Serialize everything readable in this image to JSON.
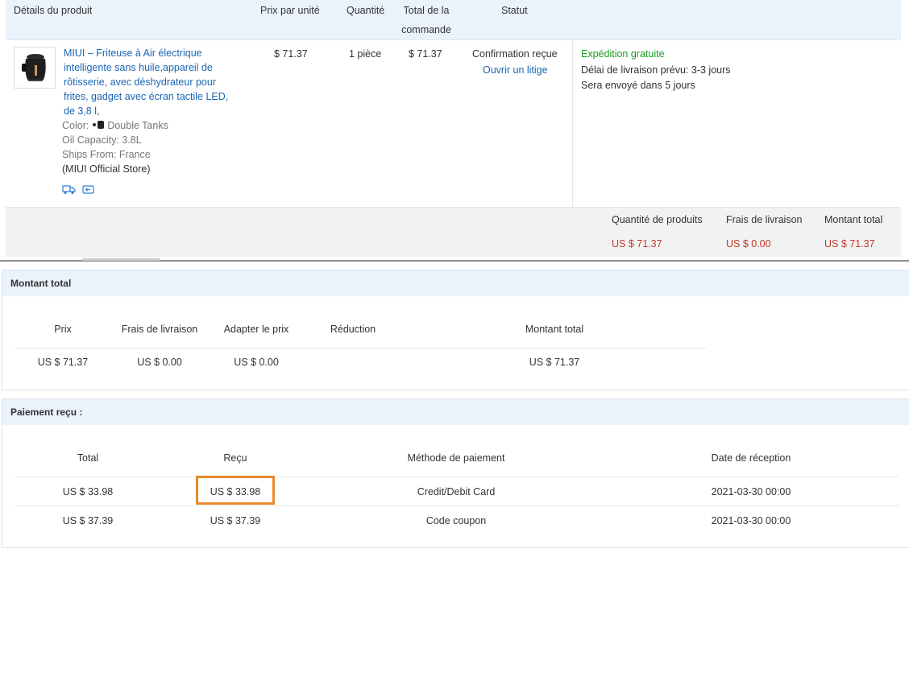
{
  "order": {
    "headers": {
      "details": "Détails du produit",
      "unit_price": "Prix par unité",
      "quantity": "Quantité",
      "order_total_line1": "Total de la",
      "order_total_line2": "commande",
      "status": "Statut"
    },
    "item": {
      "title_lines": [
        "MIUI – Friteuse à Air électrique",
        "intelligente sans huile,appareil de",
        "rôtisserie, avec déshydrateur pour",
        "frites, gadget avec écran tactile LED,",
        "de 3,8 l,"
      ],
      "color_label": "Color:",
      "color_value": "Double Tanks",
      "oil_capacity": "Oil Capacity: 3.8L",
      "ships_from": "Ships From: France",
      "store": "(MIUI Official Store)",
      "icons": [
        "shipping-truck-icon",
        "return-icon"
      ],
      "unit_price": "$ 71.37",
      "quantity": "1 pièce",
      "order_total": "$ 71.37",
      "status": "Confirmation reçue",
      "dispute_link": "Ouvrir un litige",
      "shipping_free": "Expédition gratuite",
      "delivery_estimate": "Délai de livraison prévu: 3-3 jours",
      "ship_within": "Sera envoyé dans 5 jours"
    },
    "totals": {
      "products_label": "Quantité de produits",
      "shipping_label": "Frais de livraison",
      "total_label": "Montant total",
      "products_value": "US $ 71.37",
      "shipping_value": "US $ 0.00",
      "total_value": "US $ 71.37"
    }
  },
  "amount_panel": {
    "title": "Montant total",
    "headers": [
      "Prix",
      "Frais de livraison",
      "Adapter le prix",
      "Réduction",
      "Montant total"
    ],
    "values": [
      "US $ 71.37",
      "US $ 0.00",
      "US $ 0.00",
      "",
      "US $ 71.37"
    ]
  },
  "payment_panel": {
    "title": "Paiement reçu :",
    "headers": [
      "Total",
      "Reçu",
      "Méthode de paiement",
      "Date de réception"
    ],
    "rows": [
      [
        "US $ 33.98",
        "US $ 33.98",
        "Credit/Debit Card",
        "2021-03-30 00:00"
      ],
      [
        "US $ 37.39",
        "US $ 37.39",
        "Code coupon",
        "2021-03-30 00:00"
      ]
    ],
    "highlight_color": "#e88a2d"
  },
  "colors": {
    "link": "#1a66b3",
    "free_shipping": "#1d9a20",
    "price_red": "#c0392b",
    "header_bg": "#eaf2fc"
  }
}
